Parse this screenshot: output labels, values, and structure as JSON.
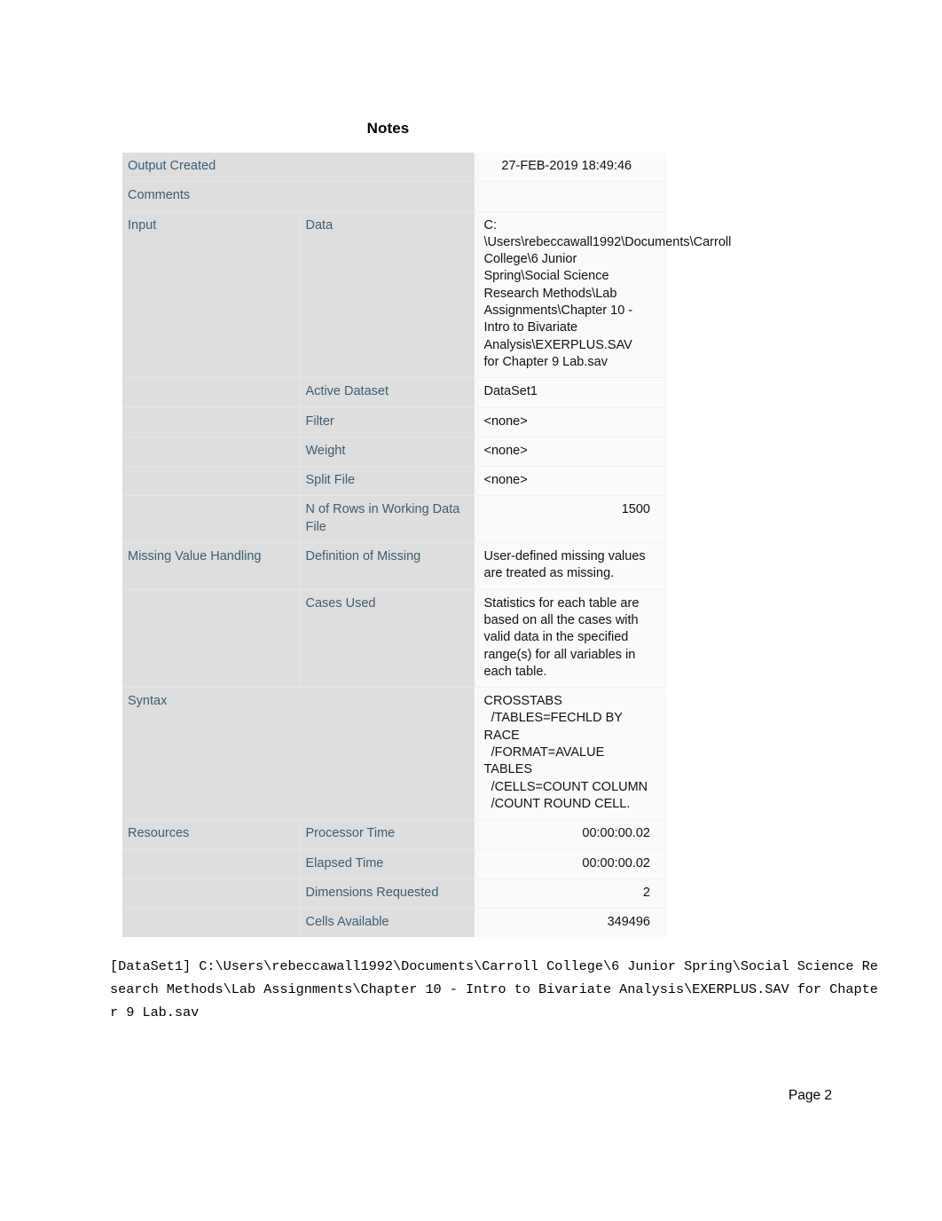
{
  "document": {
    "title": "Notes",
    "footer": "Page 2",
    "log_text": "[DataSet1] C:\\Users\\rebeccawall1992\\Documents\\Carroll College\\6 Junior Spring\\Social Science Research Methods\\Lab Assignments\\Chapter 10 - Intro to Bivariate Analysis\\EXERPLUS.SAV for Chapter 9 Lab.sav"
  },
  "colors": {
    "label_text": "#3e5c72",
    "label_background": "#dedede",
    "value_background": "#fafafa",
    "value_text": "#111111"
  },
  "notes": {
    "rows": [
      {
        "group": "Output Created",
        "sub": "",
        "value": "27-FEB-2019 18:49:46",
        "align": "center"
      },
      {
        "group": "Comments",
        "sub": "",
        "value": "",
        "align": "left"
      },
      {
        "group": "Input",
        "sub": "Data",
        "value": "C: \\Users\\rebeccawall1992\\Documents\\Carroll College\\6 Junior Spring\\Social Science Research Methods\\Lab Assignments\\Chapter 10 - Intro to Bivariate Analysis\\EXERPLUS.SAV for Chapter 9 Lab.sav",
        "align": "left"
      },
      {
        "group": "",
        "sub": "Active Dataset",
        "value": "DataSet1",
        "align": "left"
      },
      {
        "group": "",
        "sub": "Filter",
        "value": "<none>",
        "align": "left"
      },
      {
        "group": "",
        "sub": "Weight",
        "value": "<none>",
        "align": "left"
      },
      {
        "group": "",
        "sub": "Split File",
        "value": "<none>",
        "align": "left"
      },
      {
        "group": "",
        "sub": "N of Rows in Working Data File",
        "value": "1500",
        "align": "right"
      },
      {
        "group": "Missing Value Handling",
        "sub": "Definition of Missing",
        "value": "User-defined missing values are treated as missing.",
        "align": "left"
      },
      {
        "group": "",
        "sub": "Cases Used",
        "value": "Statistics for each table are based on all the cases with valid data in the specified range(s) for all variables in each table.",
        "align": "left"
      },
      {
        "group": "Syntax",
        "sub": "",
        "value": "CROSSTABS\n  /TABLES=FECHLD BY RACE\n  /FORMAT=AVALUE TABLES\n  /CELLS=COUNT COLUMN\n  /COUNT ROUND CELL.",
        "align": "left"
      },
      {
        "group": "Resources",
        "sub": "Processor Time",
        "value": "00:00:00.02",
        "align": "right"
      },
      {
        "group": "",
        "sub": "Elapsed Time",
        "value": "00:00:00.02",
        "align": "right"
      },
      {
        "group": "",
        "sub": "Dimensions Requested",
        "value": "2",
        "align": "right"
      },
      {
        "group": "",
        "sub": "Cells Available",
        "value": "349496",
        "align": "right"
      }
    ]
  }
}
